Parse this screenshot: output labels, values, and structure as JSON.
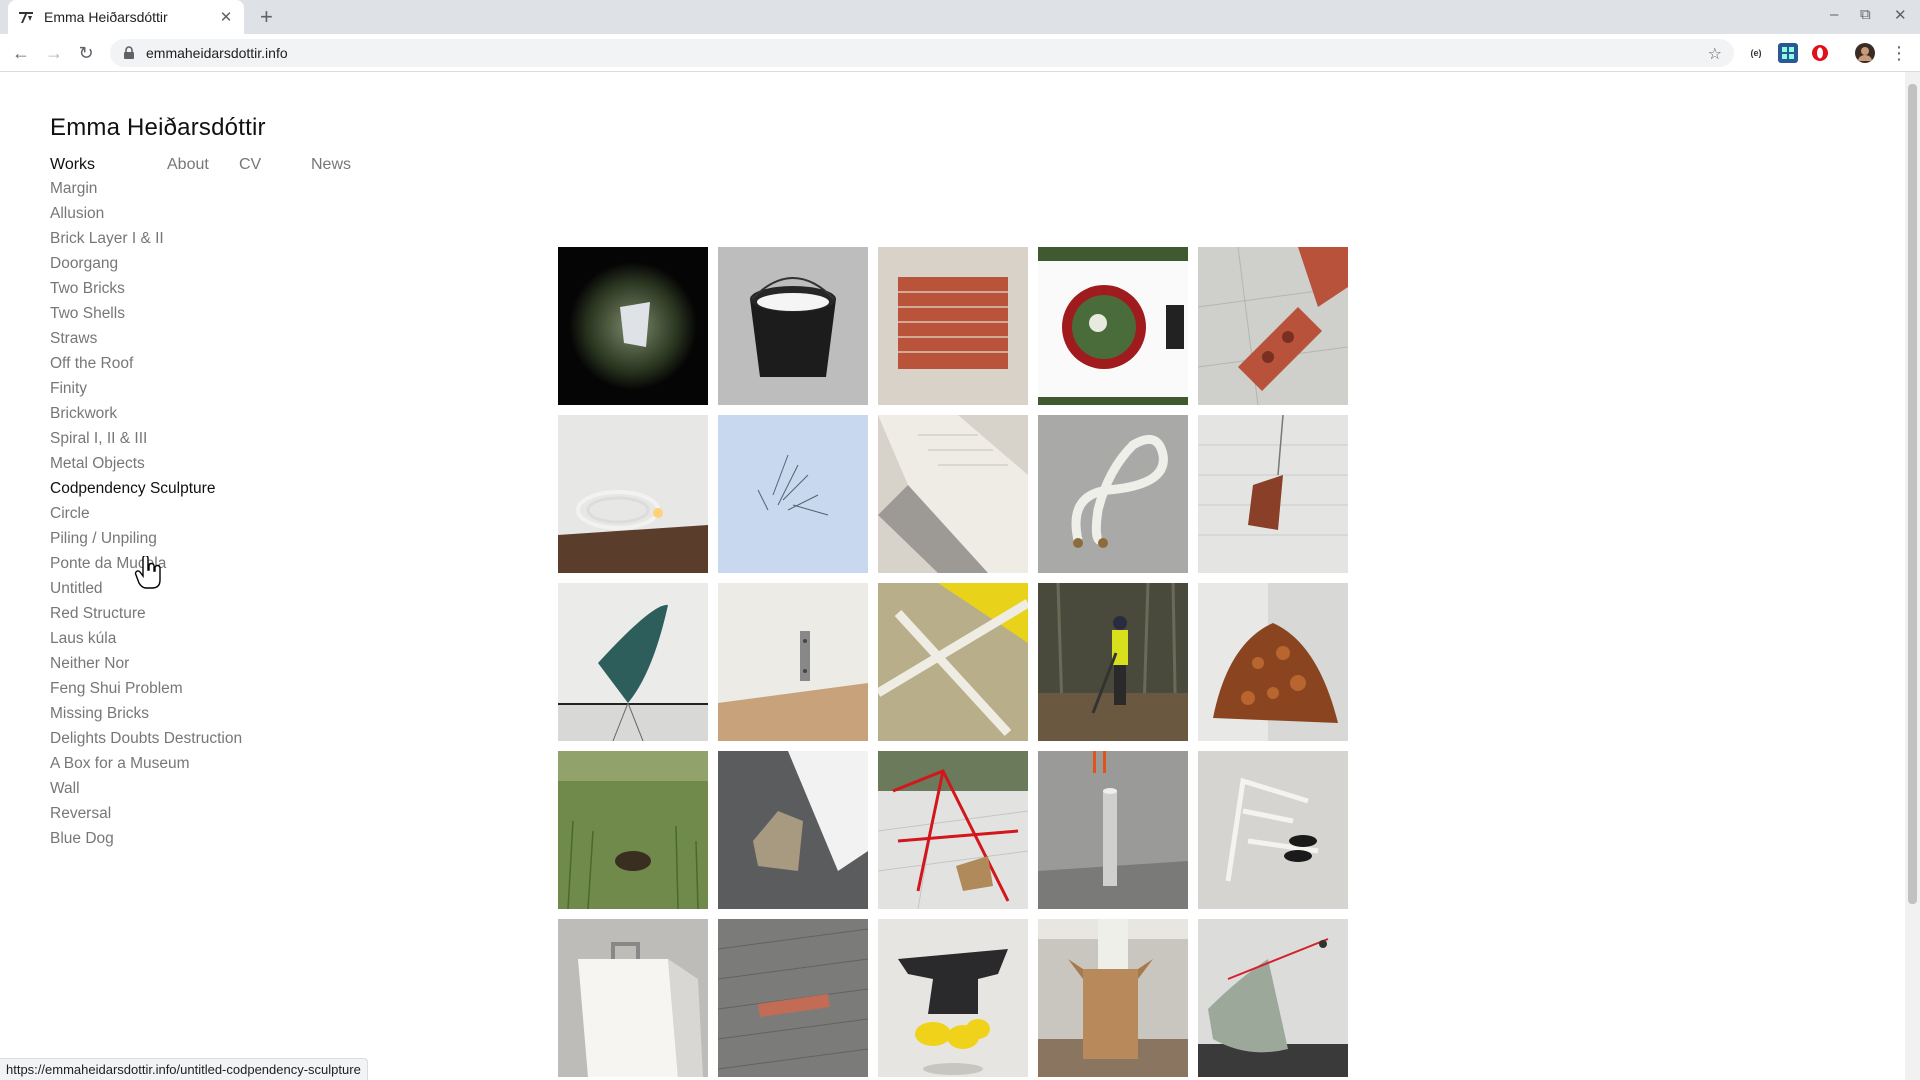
{
  "browser": {
    "tab_title": "Emma Heiðarsdóttir",
    "url": "emmaheidarsdottir.info",
    "status_url": "https://emmaheidarsdottir.info/untitled-codpendency-sculpture",
    "close_symbol": "✕",
    "newtab_symbol": "+",
    "back_symbol": "←",
    "forward_symbol": "→",
    "reload_symbol": "↻",
    "star_symbol": "☆",
    "menu_symbol": "⋮",
    "minimize_symbol": "–",
    "maximize_symbol": "⧉",
    "window_close_symbol": "✕"
  },
  "site": {
    "title": "Emma Heiðarsdóttir",
    "nav": [
      {
        "label": "Works",
        "active": true
      },
      {
        "label": "About",
        "active": false
      },
      {
        "label": "CV",
        "active": false
      },
      {
        "label": "News",
        "active": false
      }
    ],
    "works": [
      "Margin",
      "Allusion",
      "Brick Layer I & II",
      "Doorgang",
      "Two Bricks",
      "Two Shells",
      "Straws",
      "Off the Roof",
      "Finity",
      "Brickwork",
      "Spiral I, II & III",
      "Metal Objects",
      "Codpendency Sculpture",
      "Circle",
      "Piling / Unpiling",
      "Ponte da Mucela",
      "Untitled",
      "Red Structure",
      "Laus kúla",
      "Neither Nor",
      "Feng Shui Problem",
      "Missing Bricks",
      "Delights Doubts Destruction",
      "A Box for a Museum",
      "Wall",
      "Reversal",
      "Blue Dog"
    ],
    "active_work_index": 12
  },
  "thumbnails": [
    {
      "name": "dark-porthole"
    },
    {
      "name": "black-bucket"
    },
    {
      "name": "brick-wall"
    },
    {
      "name": "round-sign"
    },
    {
      "name": "brick-chain"
    },
    {
      "name": "cable-lamp"
    },
    {
      "name": "straws-on-blue"
    },
    {
      "name": "white-steps"
    },
    {
      "name": "white-hose"
    },
    {
      "name": "cracked-wall"
    },
    {
      "name": "green-cone-lamp"
    },
    {
      "name": "wall-plate"
    },
    {
      "name": "pipes-on-yellow"
    },
    {
      "name": "leaf-blower"
    },
    {
      "name": "leaf-pile"
    },
    {
      "name": "grass-field"
    },
    {
      "name": "stone-in-corner"
    },
    {
      "name": "red-structure"
    },
    {
      "name": "bollard"
    },
    {
      "name": "chair-shoes"
    },
    {
      "name": "white-box"
    },
    {
      "name": "paving-brick"
    },
    {
      "name": "anvil"
    },
    {
      "name": "cardboard-column"
    },
    {
      "name": "red-string-corner"
    }
  ]
}
